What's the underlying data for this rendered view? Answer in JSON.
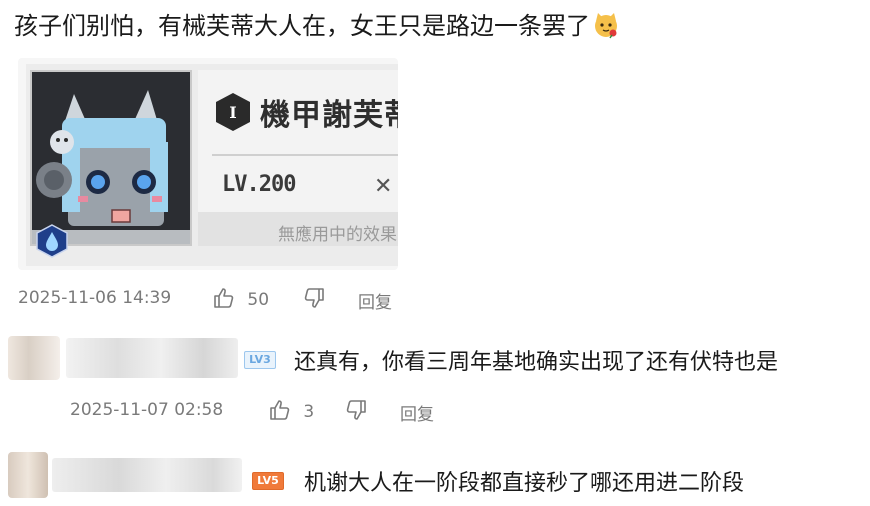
{
  "top_comment": {
    "text": "孩子们别怕，有械芙蒂大人在，女王只是路边一条罢了",
    "emoji": "cat-rose-emoji",
    "card": {
      "name": "機甲謝芙蒂",
      "rank": "I",
      "level": "LV.200",
      "effect": "無應用中的效果"
    },
    "date": "2025-11-06 14:39",
    "likes": "50",
    "reply_label": "回复"
  },
  "replies": [
    {
      "level_badge": "LV3",
      "text": "还真有，你看三周年基地确实出现了还有伏特也是",
      "date": "2025-11-07 02:58",
      "likes": "3",
      "reply_label": "回复"
    },
    {
      "level_badge": "LV5",
      "text": "机谢大人在一阶段都直接秒了哪还用进二阶段"
    }
  ],
  "colors": {
    "text": "#1a1a1a",
    "meta": "#7a7a7a",
    "lv3": "#6aa7e0",
    "lv5": "#f07a3a"
  }
}
